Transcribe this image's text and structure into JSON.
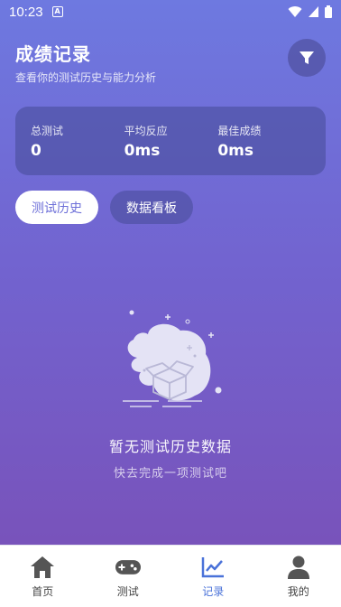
{
  "status_bar": {
    "time": "10:23",
    "notification_icon": "a-icon"
  },
  "header": {
    "title": "成绩记录",
    "subtitle": "查看你的测试历史与能力分析",
    "filter_icon": "filter-icon"
  },
  "stats": [
    {
      "label": "总测试",
      "value": "0"
    },
    {
      "label": "平均反应",
      "value": "0ms"
    },
    {
      "label": "最佳成绩",
      "value": "0ms"
    }
  ],
  "tabs": {
    "history": "测试历史",
    "dashboard": "数据看板",
    "active": "history"
  },
  "empty_state": {
    "title": "暂无测试历史数据",
    "subtitle": "快去完成一项测试吧",
    "icon": "empty-box-icon"
  },
  "nav": {
    "items": [
      {
        "label": "首页",
        "icon": "home-icon"
      },
      {
        "label": "测试",
        "icon": "gamepad-icon"
      },
      {
        "label": "记录",
        "icon": "chart-icon"
      },
      {
        "label": "我的",
        "icon": "user-icon"
      }
    ],
    "active_index": 2
  },
  "colors": {
    "accent": "#4a72d9",
    "bg_top": "#6e79e0",
    "bg_bottom": "#7a4fb6"
  }
}
